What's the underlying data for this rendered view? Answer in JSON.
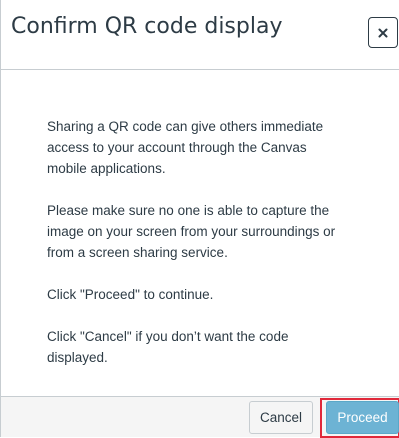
{
  "dialog": {
    "title": "Confirm QR code display",
    "close_icon": "close-icon",
    "paragraphs": {
      "intro": "Sharing a QR code can give others immediate access to your account through the Canvas mobile applications.",
      "warning": "Please make sure no one is able to capture the image on your screen from your surroundings or from a screen sharing service.",
      "proceed_hint": "Click \"Proceed\" to continue.",
      "cancel_hint": "Click \"Cancel\" if you don’t want the code displayed."
    },
    "buttons": {
      "cancel_label": "Cancel",
      "proceed_label": "Proceed"
    }
  },
  "colors": {
    "text": "#2d3b45",
    "border": "#c7cdd1",
    "footer_bg": "#f5f5f5",
    "primary_button": "#6db3d4",
    "highlight_outline": "#e0283a"
  }
}
